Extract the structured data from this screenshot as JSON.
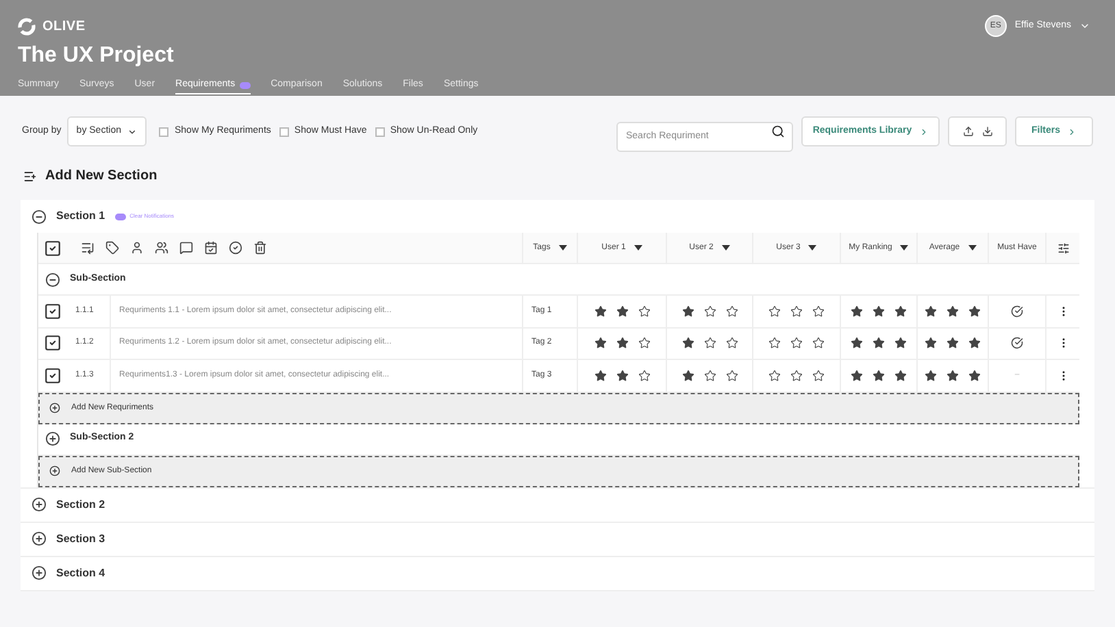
{
  "brand": "OLIVE",
  "project_title": "The UX Project",
  "user": {
    "initials": "ES",
    "name": "Effie Stevens"
  },
  "tabs": [
    {
      "label": "Summary",
      "selected": false,
      "badge": false
    },
    {
      "label": "Surveys",
      "selected": false,
      "badge": false
    },
    {
      "label": "User",
      "selected": false,
      "badge": false
    },
    {
      "label": "Requirements",
      "selected": true,
      "badge": true
    },
    {
      "label": "Comparison",
      "selected": false,
      "badge": false
    },
    {
      "label": "Solutions",
      "selected": false,
      "badge": false
    },
    {
      "label": "Files",
      "selected": false,
      "badge": false
    },
    {
      "label": "Settings",
      "selected": false,
      "badge": false
    }
  ],
  "toolbar": {
    "group_by_label": "Group by",
    "group_by_value": "by Section",
    "filters": [
      {
        "label": "Show My Requriments",
        "checked": false
      },
      {
        "label": "Show Must Have",
        "checked": false
      },
      {
        "label": "Show Un-Read Only",
        "checked": false
      }
    ],
    "search": {
      "placeholder": "Search Requriment"
    },
    "library_button": "Requirements Library",
    "filters_button": "Filters"
  },
  "add_section": "Add New Section",
  "sections": [
    {
      "title": "Section 1",
      "expanded": true,
      "clear_notifications": "Clear Notifications",
      "table": {
        "select_all": true,
        "columns": [
          "Tags",
          "User 1",
          "User 2",
          "User 3",
          "My Ranking",
          "Average",
          "Must Have"
        ],
        "subsections": [
          {
            "title": "Sub-Section",
            "expanded": true,
            "rows": [
              {
                "checked": true,
                "number": "1.1.1",
                "text": "Requriments 1.1 - Lorem ipsum dolor sit amet, consectetur adipiscing elit...",
                "tag": "Tag 1",
                "ratings": [
                  {
                    "stars": 2
                  },
                  {
                    "stars": 1
                  },
                  {
                    "stars": 0
                  },
                  {
                    "stars": 3
                  },
                  {
                    "stars": 3
                  }
                ],
                "must_have": true,
                "must_have_placeholder": ""
              },
              {
                "checked": true,
                "number": "1.1.2",
                "text": "Requriments 1.2 - Lorem ipsum dolor sit amet, consectetur adipiscing elit...",
                "tag": "Tag 2",
                "ratings": [
                  {
                    "stars": 2
                  },
                  {
                    "stars": 1
                  },
                  {
                    "stars": 0
                  },
                  {
                    "stars": 3
                  },
                  {
                    "stars": 3
                  }
                ],
                "must_have": true,
                "must_have_placeholder": ""
              },
              {
                "checked": true,
                "number": "1.1.3",
                "text": "Requriments1.3 - Lorem ipsum dolor sit amet, consectetur adipiscing elit...",
                "tag": "Tag 3",
                "ratings": [
                  {
                    "stars": 2
                  },
                  {
                    "stars": 1
                  },
                  {
                    "stars": 0
                  },
                  {
                    "stars": 3
                  },
                  {
                    "stars": 3
                  }
                ],
                "must_have": false,
                "must_have_placeholder": "–"
              }
            ],
            "add_label": "Add New Requriments"
          },
          {
            "title": "Sub-Section 2",
            "expanded": false
          }
        ],
        "add_subsection": "Add New Sub-Section"
      }
    },
    {
      "title": "Section 2",
      "expanded": false
    },
    {
      "title": "Section 3",
      "expanded": false
    },
    {
      "title": "Section 4",
      "expanded": false
    }
  ]
}
